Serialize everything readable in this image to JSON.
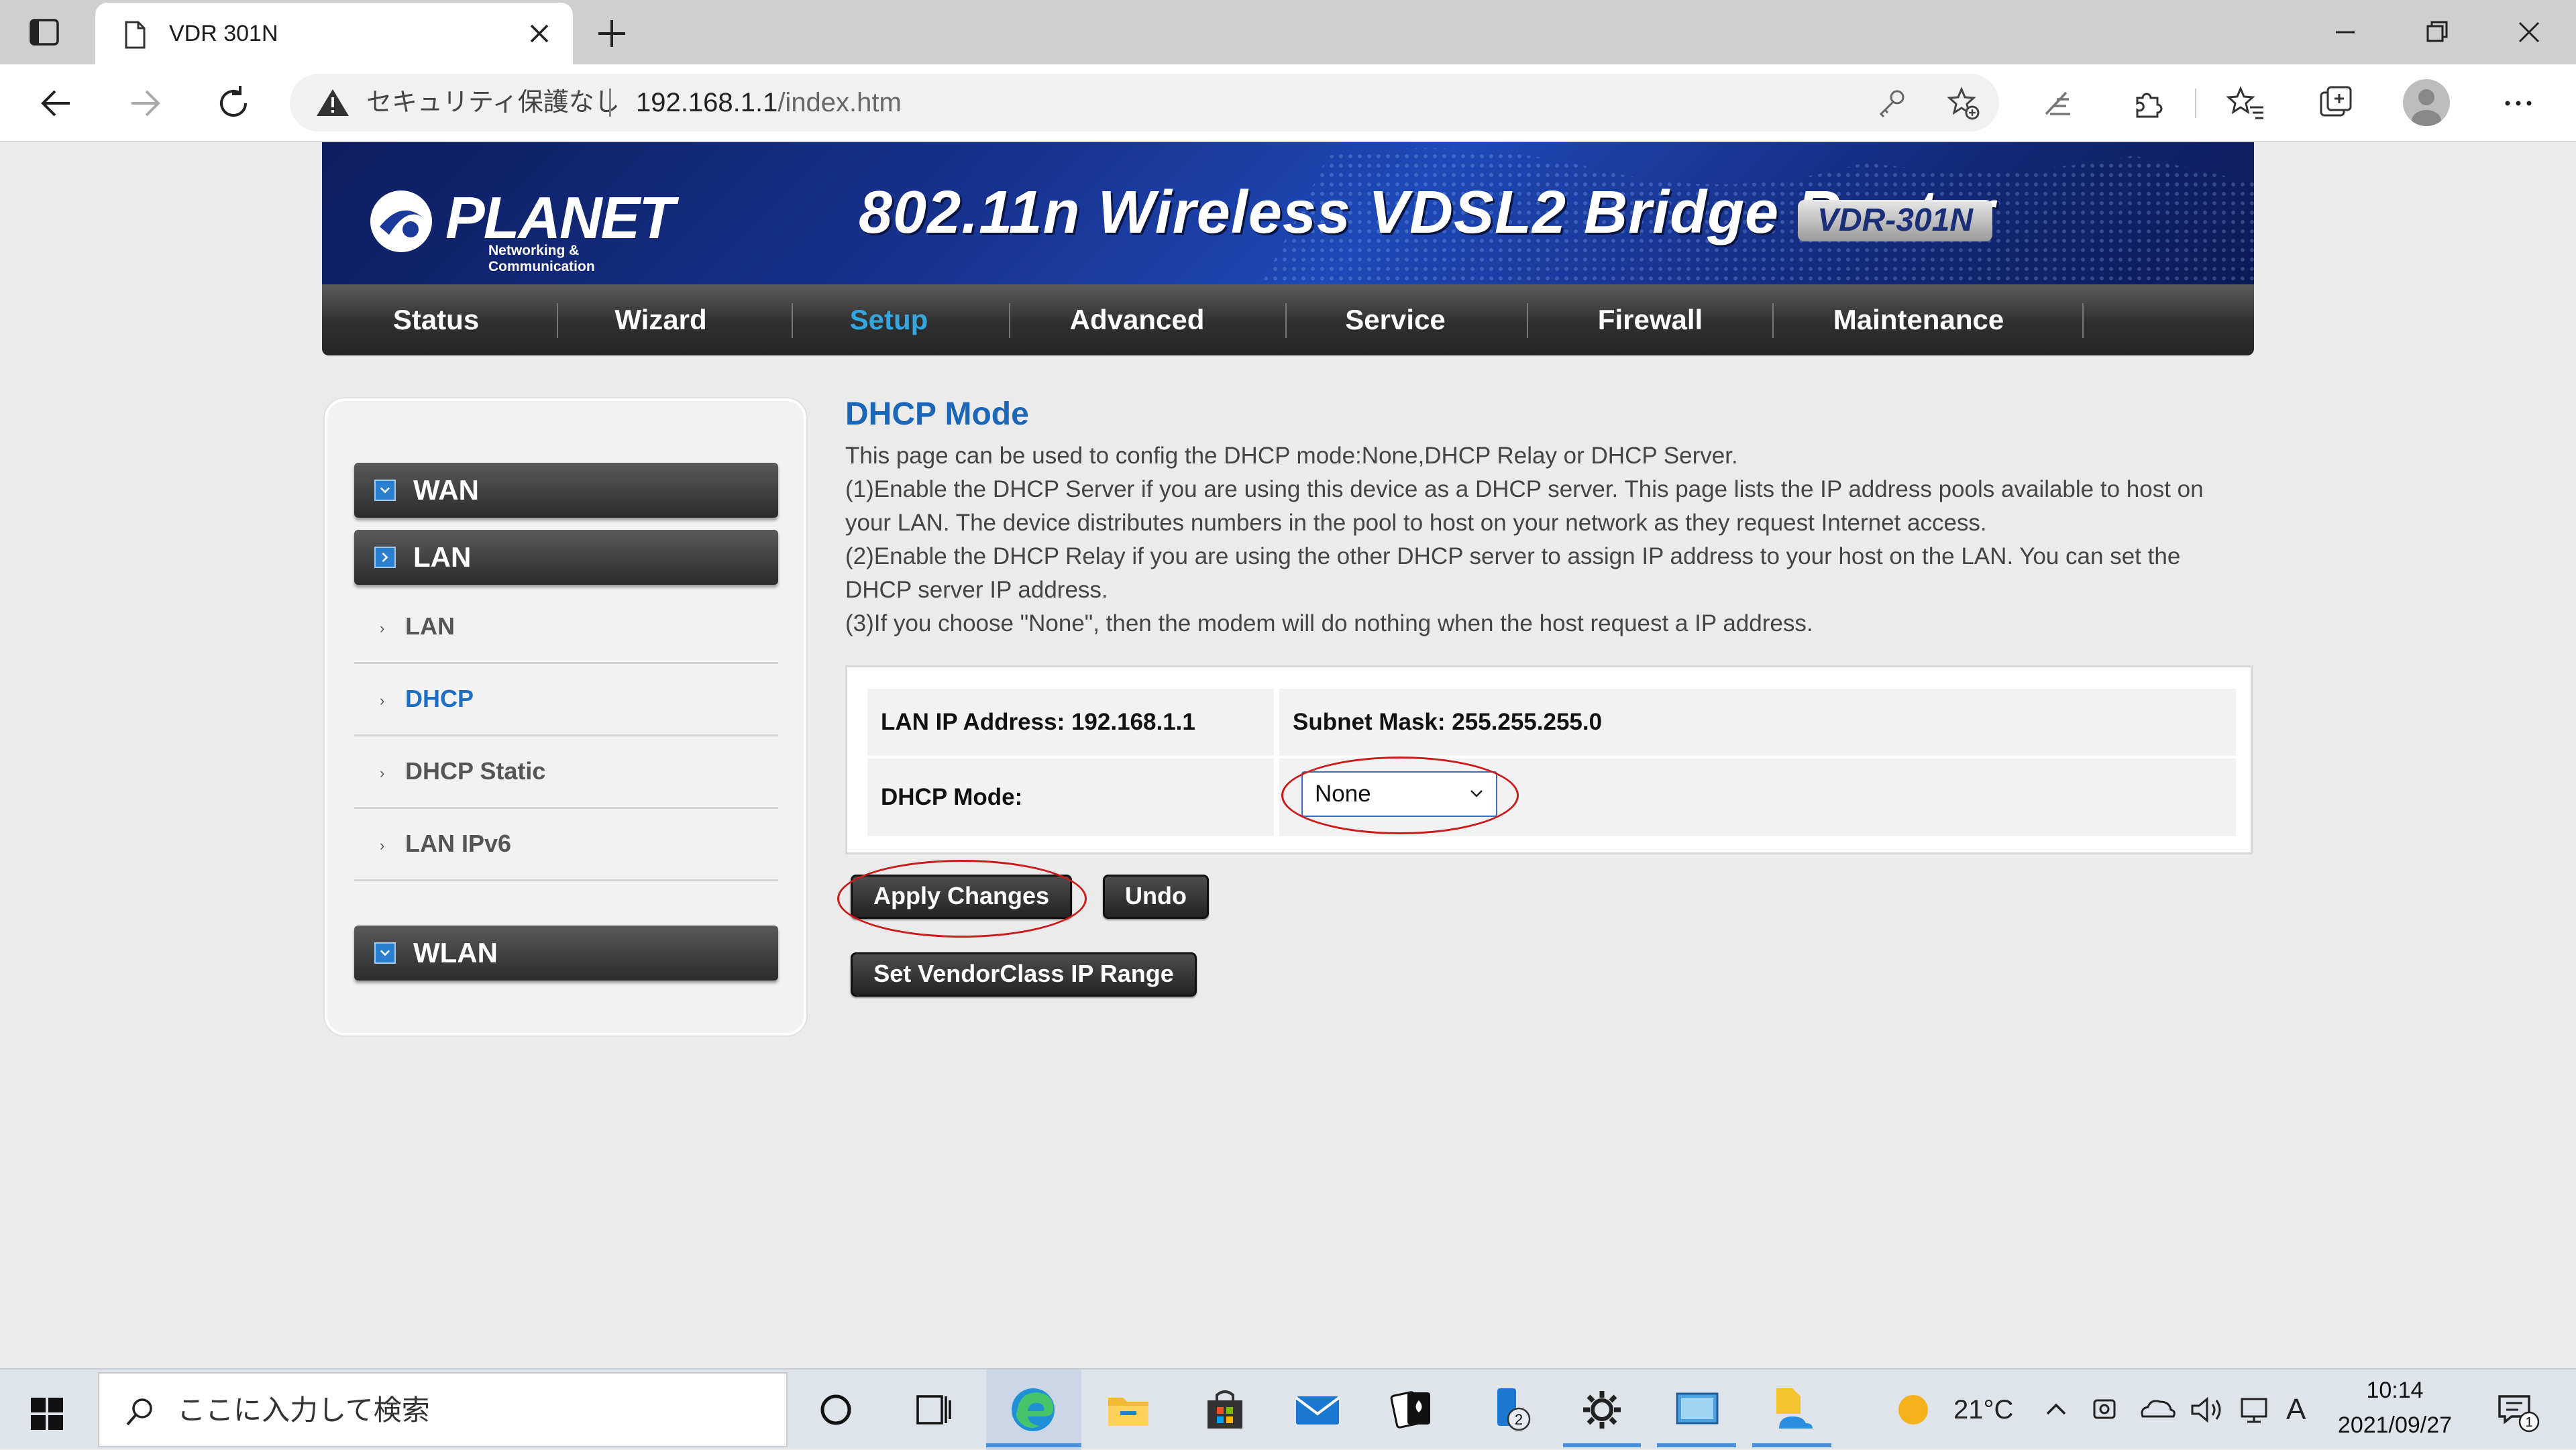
{
  "browser": {
    "tab_title": "VDR 301N",
    "security_label": "セキュリティ保護なし",
    "url_host": "192.168.1.1",
    "url_path": "/index.htm"
  },
  "banner": {
    "logo_text": "PLANET",
    "logo_sub": "Networking & Communication",
    "product_title": "802.11n Wireless VDSL2 Bridge Router",
    "model": "VDR-301N"
  },
  "nav": {
    "items": [
      {
        "label": "Status"
      },
      {
        "label": "Wizard"
      },
      {
        "label": "Setup",
        "active": true
      },
      {
        "label": "Advanced"
      },
      {
        "label": "Service"
      },
      {
        "label": "Firewall"
      },
      {
        "label": "Maintenance"
      }
    ]
  },
  "sidebar": {
    "wan": "WAN",
    "lan": "LAN",
    "lan_items": [
      {
        "label": "LAN"
      },
      {
        "label": "DHCP",
        "active": true
      },
      {
        "label": "DHCP Static"
      },
      {
        "label": "LAN IPv6"
      }
    ],
    "wlan": "WLAN"
  },
  "main": {
    "title": "DHCP Mode",
    "desc": [
      "This page can be used to config the DHCP mode:None,DHCP Relay or DHCP Server.",
      "(1)Enable the DHCP Server if you are using this device as a DHCP server. This page lists the IP address pools available to host on",
      "your LAN. The device distributes numbers in the pool to host on your network as they request Internet access.",
      "(2)Enable the DHCP Relay if you are using the other DHCP server to assign IP address to your host on the LAN. You can set the",
      "DHCP server IP address.",
      "(3)If you choose \"None\", then the modem will do nothing when the host request a IP address."
    ],
    "lan_ip": "LAN IP Address: 192.168.1.1",
    "subnet": "Subnet Mask: 255.255.255.0",
    "dhcp_mode_label": "DHCP Mode:",
    "dhcp_mode_value": "None",
    "apply": "Apply Changes",
    "undo": "Undo",
    "vendor": "Set VendorClass IP Range",
    "highlight_color": "#cc1a1a"
  },
  "taskbar": {
    "search_placeholder": "ここに入力して検索",
    "temperature": "21°C",
    "ime": "A",
    "time": "10:14",
    "date": "2021/09/27",
    "store_badge": "2",
    "notification_count": "1"
  }
}
